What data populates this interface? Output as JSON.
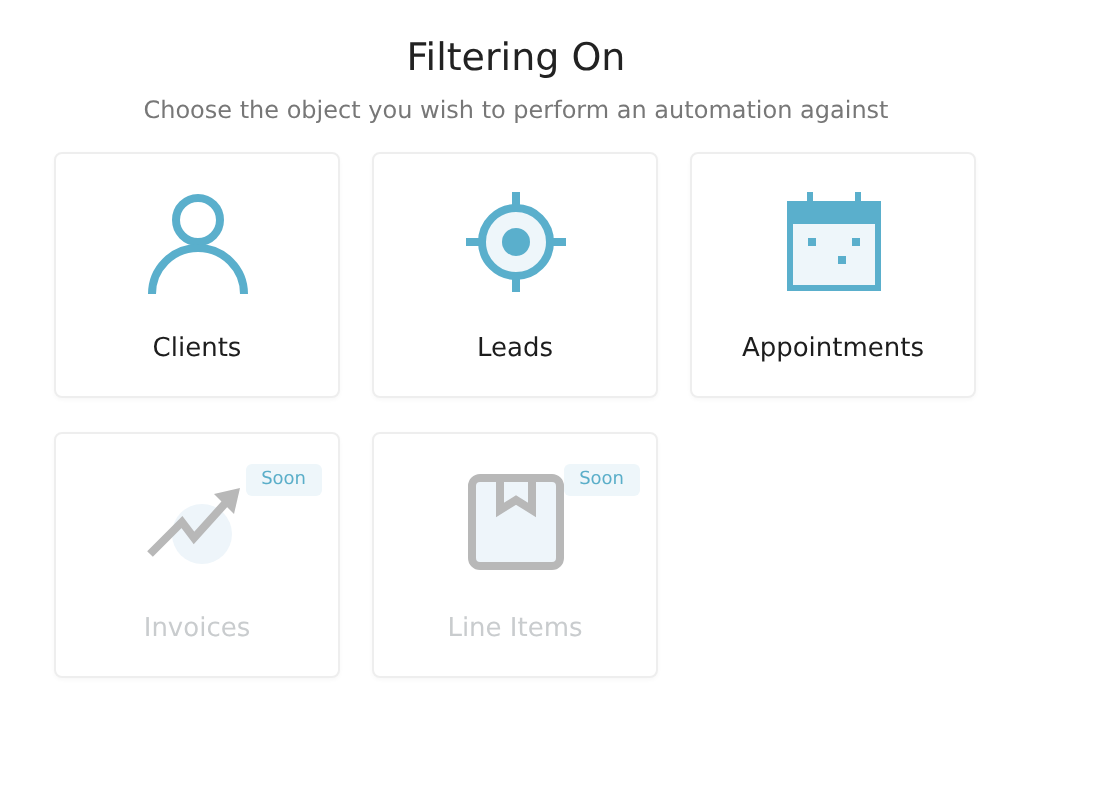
{
  "title": "Filtering On",
  "subtitle": "Choose the object you wish to perform an automation against",
  "objects": [
    {
      "label": "Clients",
      "kind": "person",
      "disabled": false
    },
    {
      "label": "Leads",
      "kind": "target",
      "disabled": false
    },
    {
      "label": "Appointments",
      "kind": "calendar",
      "disabled": false
    },
    {
      "label": "Invoices",
      "kind": "trend",
      "disabled": true,
      "badge": "Soon"
    },
    {
      "label": "Line Items",
      "kind": "box",
      "disabled": true,
      "badge": "Soon"
    }
  ]
}
